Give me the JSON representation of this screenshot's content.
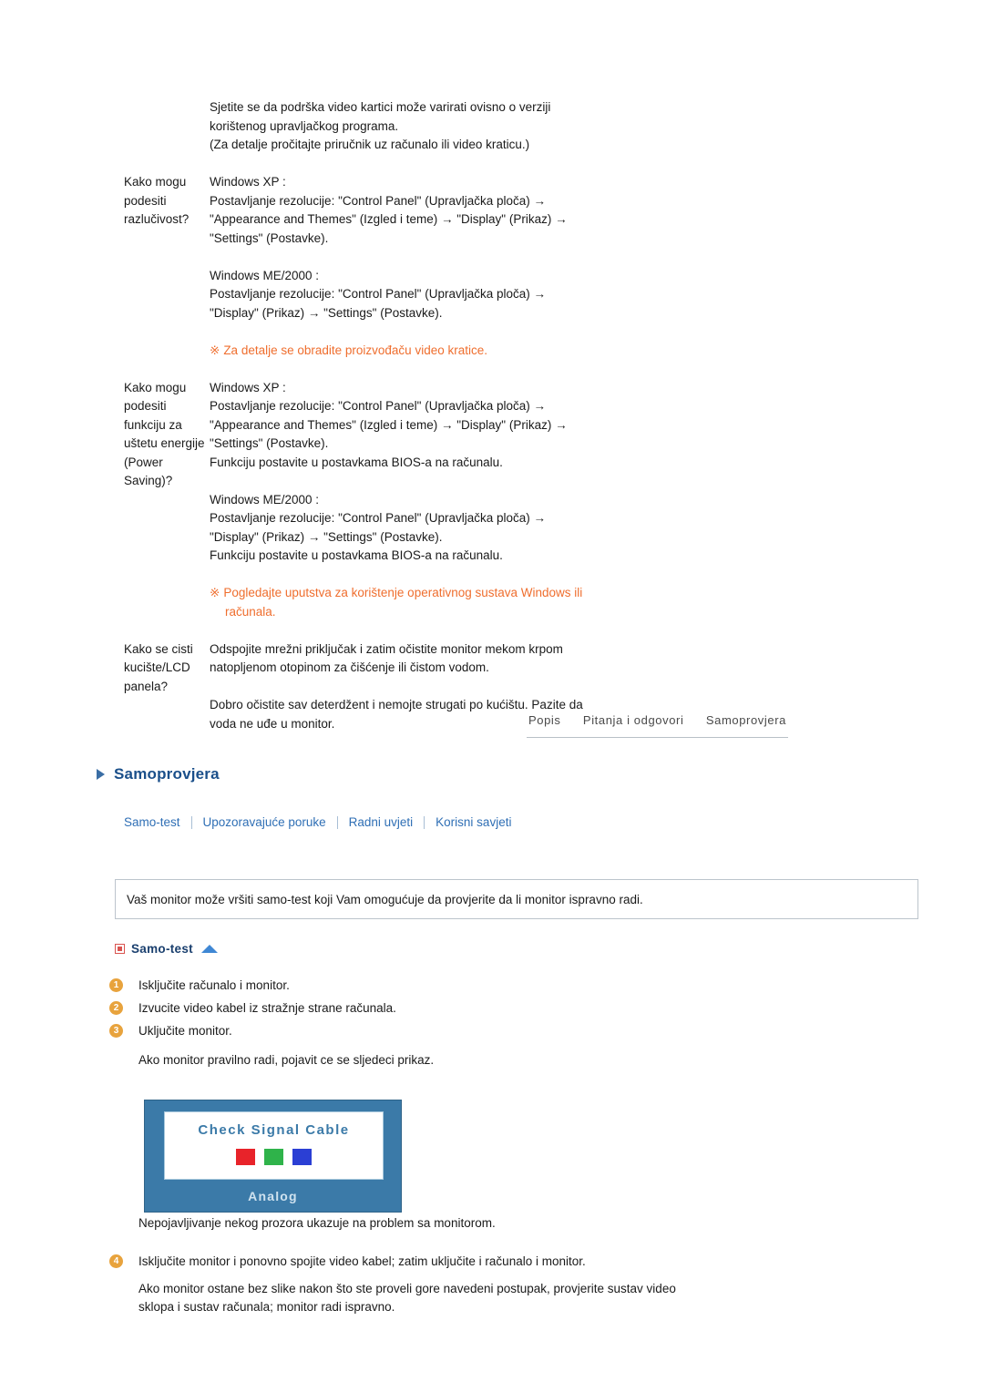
{
  "faq": {
    "intro_lines": [
      "Sjetite se da podrška video kartici može varirati ovisno o verziji",
      "korištenog upravljačkog programa.",
      "(Za detalje pročitajte priručnik uz računalo ili video kraticu.)"
    ],
    "rows": [
      {
        "question": "Kako mogu podesiti razlučivost?",
        "blocks": [
          {
            "lines": [
              "Windows XP :",
              "Postavljanje rezolucije: \"Control Panel\" (Upravljačka ploča) →",
              "\"Appearance and Themes\" (Izgled i teme) → \"Display\" (Prikaz) →",
              "\"Settings\" (Postavke)."
            ]
          },
          {
            "lines": [
              "Windows ME/2000 :",
              "Postavljanje rezolucije: \"Control Panel\" (Upravljačka ploča) →",
              "\"Display\" (Prikaz) → \"Settings\" (Postavke)."
            ]
          }
        ],
        "note": "Za detalje se obradite proizvođaču video kratice.",
        "note_second_line": ""
      },
      {
        "question": "Kako mogu podesiti funkciju za uštetu energije (Power Saving)?",
        "blocks": [
          {
            "lines": [
              "Windows XP :",
              "Postavljanje rezolucije: \"Control Panel\" (Upravljačka ploča) →",
              "\"Appearance and Themes\" (Izgled i teme) → \"Display\" (Prikaz) →",
              "\"Settings\" (Postavke).",
              "Funkciju postavite u postavkama BIOS-a na računalu."
            ]
          },
          {
            "lines": [
              "Windows ME/2000 :",
              "Postavljanje rezolucije: \"Control Panel\" (Upravljačka ploča) →",
              "\"Display\" (Prikaz) → \"Settings\" (Postavke).",
              "Funkciju postavite u postavkama BIOS-a na računalu."
            ]
          }
        ],
        "note": "Pogledajte uputstva za korištenje operativnog sustava Windows ili",
        "note_second_line": "računala."
      },
      {
        "question": "Kako se cisti kucište/LCD panela?",
        "blocks": [
          {
            "lines": [
              "Odspojite mrežni priključak i zatim očistite monitor mekom krpom",
              "natopljenom otopinom za čišćenje ili čistom vodom."
            ]
          },
          {
            "lines": [
              "Dobro očistite sav deterdžent i nemojte strugati po kućištu. Pazite da",
              "voda ne uđe u monitor."
            ]
          }
        ],
        "note": "",
        "note_second_line": ""
      }
    ]
  },
  "nav_tabs": [
    {
      "label": "Popis"
    },
    {
      "label": "Pitanja i odgovori"
    },
    {
      "label": "Samoprovjera"
    }
  ],
  "section": {
    "title": "Samoprovjera"
  },
  "sublinks": [
    {
      "label": "Samo-test"
    },
    {
      "label": "Upozoravajuće poruke"
    },
    {
      "label": "Radni uvjeti"
    },
    {
      "label": "Korisni savjeti"
    }
  ],
  "callout": {
    "text": "Vaš monitor može vršiti samo-test koji Vam omogućuje da provjerite da li monitor ispravno radi."
  },
  "selftest": {
    "heading": "Samo-test",
    "steps": [
      {
        "num": "1",
        "text": "Isključite računalo i monitor."
      },
      {
        "num": "2",
        "text": "Izvucite video kabel iz stražnje strane računala."
      },
      {
        "num": "3",
        "text": "Uključite monitor."
      }
    ],
    "after_steps_text": "Ako monitor pravilno radi, pojavit ce se sljedeci prikaz.",
    "monitor": {
      "message": "Check Signal Cable",
      "label": "Analog",
      "swatch_colors": [
        "#e8232a",
        "#2fb34a",
        "#2b3fd4"
      ],
      "body_color": "#3b7aa8"
    },
    "after_graphic_text": "Nepojavljivanje nekog prozora ukazuje na problem sa monitorom.",
    "step4": {
      "num": "4",
      "text": "Isključite monitor i ponovno spojite video kabel; zatim uključite i računalo i monitor."
    },
    "final_lines": [
      "Ako monitor ostane bez slike nakon što ste proveli gore navedeni postupak, provjerite sustav video",
      "sklopa i sustav računala; monitor radi ispravno."
    ]
  },
  "colors": {
    "note_orange": "#ef6e2e",
    "link_blue": "#2f6fb5",
    "heading_blue": "#1a4f8a"
  }
}
